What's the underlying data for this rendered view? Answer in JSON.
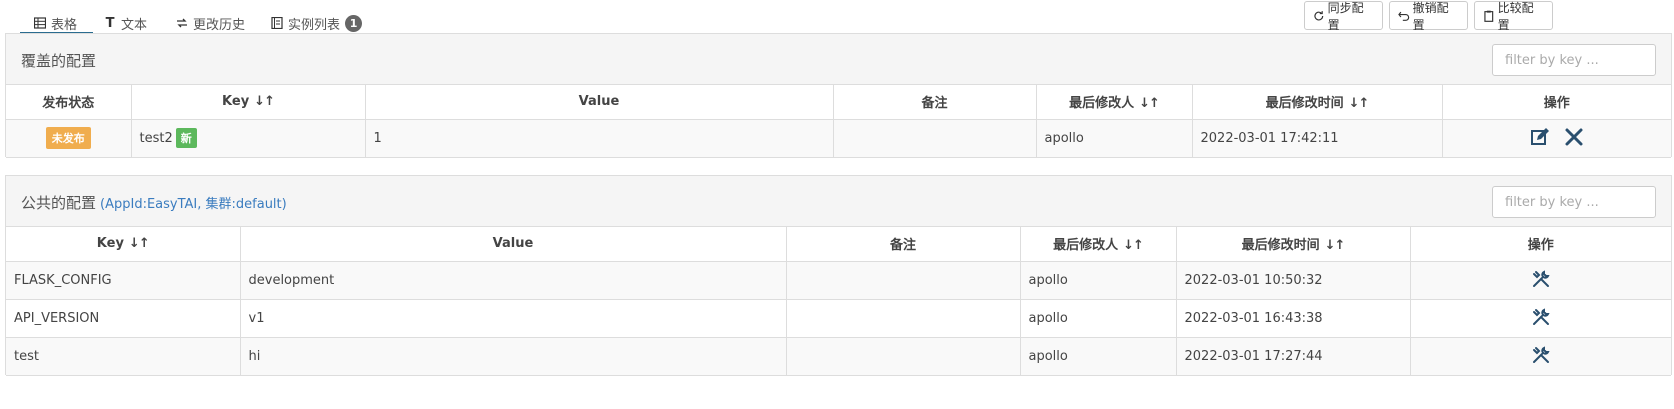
{
  "tabs": [
    {
      "label": "表格",
      "icon": "table-icon"
    },
    {
      "label": "文本",
      "icon": "text-icon"
    },
    {
      "label": "更改历史",
      "icon": "history-icon"
    },
    {
      "label": "实例列表",
      "icon": "instance-list-icon",
      "badge": "1"
    }
  ],
  "actions": {
    "sync": "同步配置",
    "revoke": "撤销配置",
    "compare": "比较配置"
  },
  "override": {
    "title": "覆盖的配置",
    "filter_placeholder": "filter by key ...",
    "columns": {
      "status": "发布状态",
      "key": "Key",
      "value": "Value",
      "comment": "备注",
      "modifier": "最后修改人",
      "time": "最后修改时间",
      "op": "操作"
    },
    "sort_glyph": "↓↑",
    "rows": [
      {
        "status": "未发布",
        "key": "test2",
        "new_tag": "新",
        "value": "1",
        "comment": "",
        "modifier": "apollo",
        "time": "2022-03-01 17:42:11"
      }
    ]
  },
  "public": {
    "title": "公共的配置",
    "subtitle": "(AppId:EasyTAI, 集群:default)",
    "filter_placeholder": "filter by key ...",
    "columns": {
      "key": "Key",
      "value": "Value",
      "comment": "备注",
      "modifier": "最后修改人",
      "time": "最后修改时间",
      "op": "操作"
    },
    "rows": [
      {
        "key": "FLASK_CONFIG",
        "value": "development",
        "comment": "",
        "modifier": "apollo",
        "time": "2022-03-01 10:50:32"
      },
      {
        "key": "API_VERSION",
        "value": "v1",
        "comment": "",
        "modifier": "apollo",
        "time": "2022-03-01 16:43:38"
      },
      {
        "key": "test",
        "value": "hi",
        "comment": "",
        "modifier": "apollo",
        "time": "2022-03-01 17:27:44"
      }
    ]
  },
  "colors": {
    "accent": "#2a6c8f",
    "unpublished": "#f0ad4e",
    "new": "#5cb85c",
    "link": "#3a7cbf"
  }
}
